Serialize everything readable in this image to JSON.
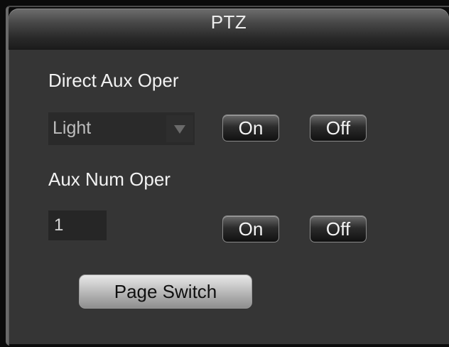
{
  "window": {
    "title": "PTZ"
  },
  "direct_aux": {
    "label": "Direct Aux Oper",
    "dropdown_value": "Light",
    "on_label": "On",
    "off_label": "Off"
  },
  "aux_num": {
    "label": "Aux Num Oper",
    "input_value": "1",
    "on_label": "On",
    "off_label": "Off"
  },
  "footer": {
    "page_switch_label": "Page Switch"
  },
  "icons": {
    "dropdown_arrow": "chevron-down-icon"
  },
  "colors": {
    "panel_bg": "#353535",
    "title_text": "#ececec",
    "page_switch_bg": "#c4c4c4"
  }
}
